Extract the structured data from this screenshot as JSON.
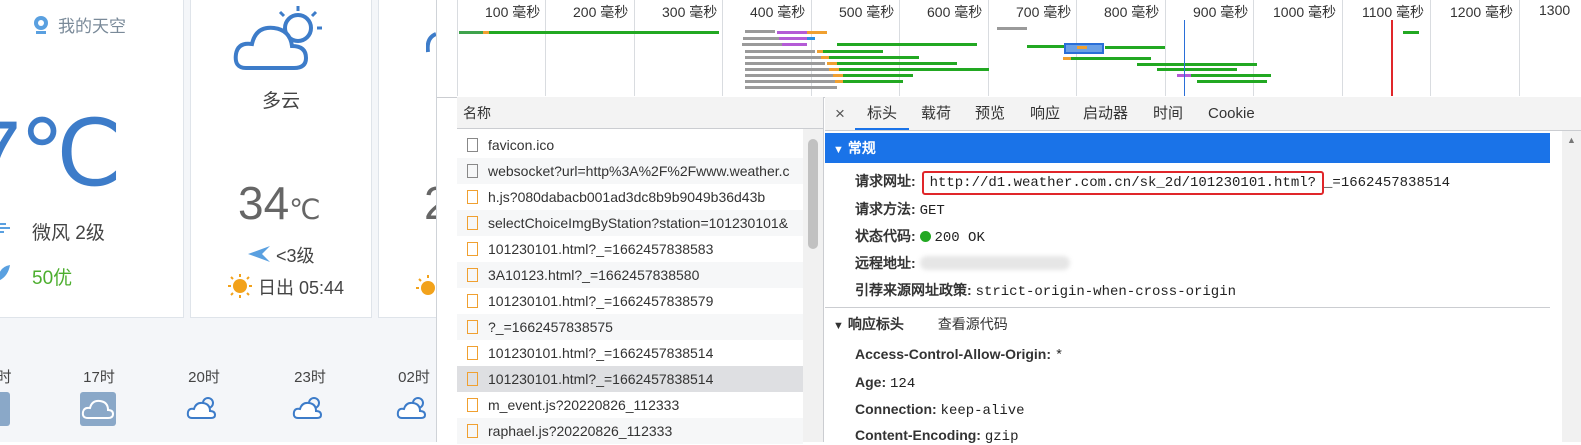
{
  "weather": {
    "location": "我的天空",
    "current_temp": "7℃",
    "wind": "微风 2级",
    "aqi": "50优",
    "forecast": {
      "condition": "多云",
      "temp_value": "34",
      "temp_unit": "℃",
      "wind": "<3级",
      "sunrise": "日出 05:44"
    },
    "hours": [
      "时",
      "17时",
      "20时",
      "23时",
      "02时"
    ],
    "next_card_temp": "2"
  },
  "timeline": {
    "ticks": [
      "100 毫秒",
      "200 毫秒",
      "300 毫秒",
      "400 毫秒",
      "500 毫秒",
      "600 毫秒",
      "700 毫秒",
      "800 毫秒",
      "900 毫秒",
      "1000 毫秒",
      "1100 毫秒",
      "1200 毫秒",
      "1300"
    ]
  },
  "requests": {
    "header": "名称",
    "items": [
      {
        "name": "favicon.ico",
        "type": "doc"
      },
      {
        "name": "websocket?url=http%3A%2F%2Fwww.weather.c",
        "type": "doc"
      },
      {
        "name": "h.js?080dabacb001ad3dc8b9b9049b36d43b",
        "type": "js"
      },
      {
        "name": "selectChoiceImgByStation?station=101230101&",
        "type": "js"
      },
      {
        "name": "101230101.html?_=1662457838583",
        "type": "js"
      },
      {
        "name": "3A10123.html?_=1662457838580",
        "type": "js"
      },
      {
        "name": "101230101.html?_=1662457838579",
        "type": "js"
      },
      {
        "name": "?_=1662457838575",
        "type": "js"
      },
      {
        "name": "101230101.html?_=1662457838514",
        "type": "js"
      },
      {
        "name": "101230101.html?_=1662457838514",
        "type": "js"
      },
      {
        "name": "m_event.js?20220826_112333",
        "type": "js"
      },
      {
        "name": "raphael.js?20220826_112333",
        "type": "js"
      }
    ]
  },
  "detail": {
    "close": "×",
    "tabs": [
      "标头",
      "载荷",
      "预览",
      "响应",
      "启动器",
      "时间",
      "Cookie"
    ],
    "general": {
      "title": "常规",
      "request_url_label": "请求网址:",
      "request_url_highlight": "http://d1.weather.com.cn/sk_2d/101230101.html?",
      "request_url_rest": "_=1662457838514",
      "method_label": "请求方法:",
      "method": "GET",
      "status_label": "状态代码:",
      "status": "200 OK",
      "remote_label": "远程地址:",
      "referrer_label": "引荐来源网址政策:",
      "referrer": "strict-origin-when-cross-origin"
    },
    "response_headers": {
      "title": "响应标头",
      "view_source": "查看源代码",
      "items": [
        {
          "k": "Access-Control-Allow-Origin:",
          "v": "*"
        },
        {
          "k": "Age:",
          "v": "124"
        },
        {
          "k": "Connection:",
          "v": "keep-alive"
        },
        {
          "k": "Content-Encoding:",
          "v": "gzip"
        }
      ]
    }
  },
  "colors": {
    "accent": "#1a73e8",
    "highlight_box": "#e0262a",
    "weather_blue": "#3d7cc9",
    "aqi_green": "#4cae2e",
    "status_green": "#22a822"
  }
}
